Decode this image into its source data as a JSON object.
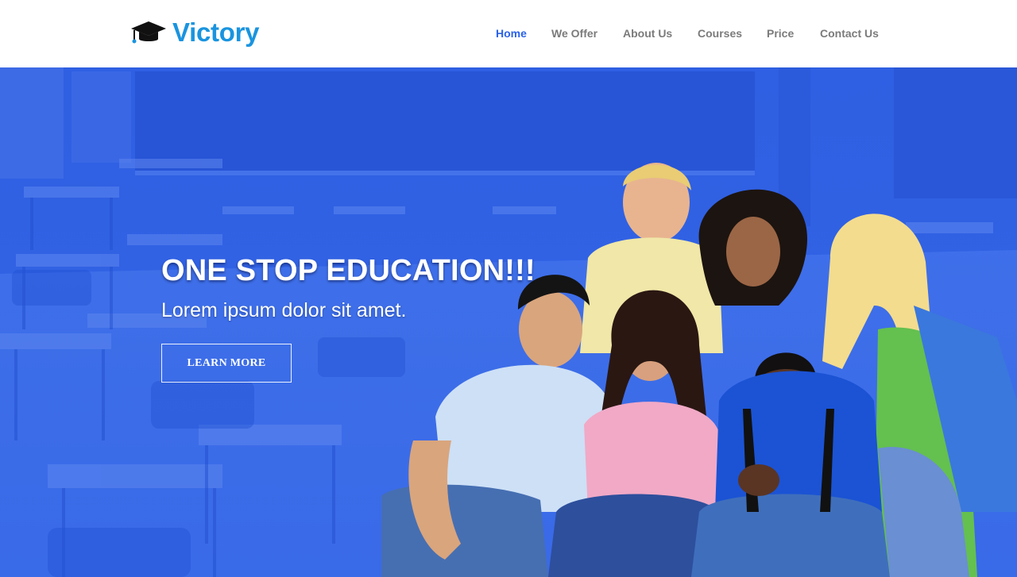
{
  "brand": {
    "name": "Victory",
    "icon": "graduation-cap-icon",
    "color": "#1a94df"
  },
  "nav": {
    "items": [
      {
        "label": "Home",
        "active": true
      },
      {
        "label": "We Offer",
        "active": false
      },
      {
        "label": "About Us",
        "active": false
      },
      {
        "label": "Courses",
        "active": false
      },
      {
        "label": "Price",
        "active": false
      },
      {
        "label": "Contact Us",
        "active": false
      }
    ],
    "active_color": "#2a62e8",
    "inactive_color": "#7b7b7b"
  },
  "hero": {
    "title": "ONE STOP EDUCATION!!!",
    "subtitle": "Lorem ipsum dolor sit amet.",
    "button_label": "LEARN MORE",
    "overlay_color": "#2f5ee0"
  }
}
